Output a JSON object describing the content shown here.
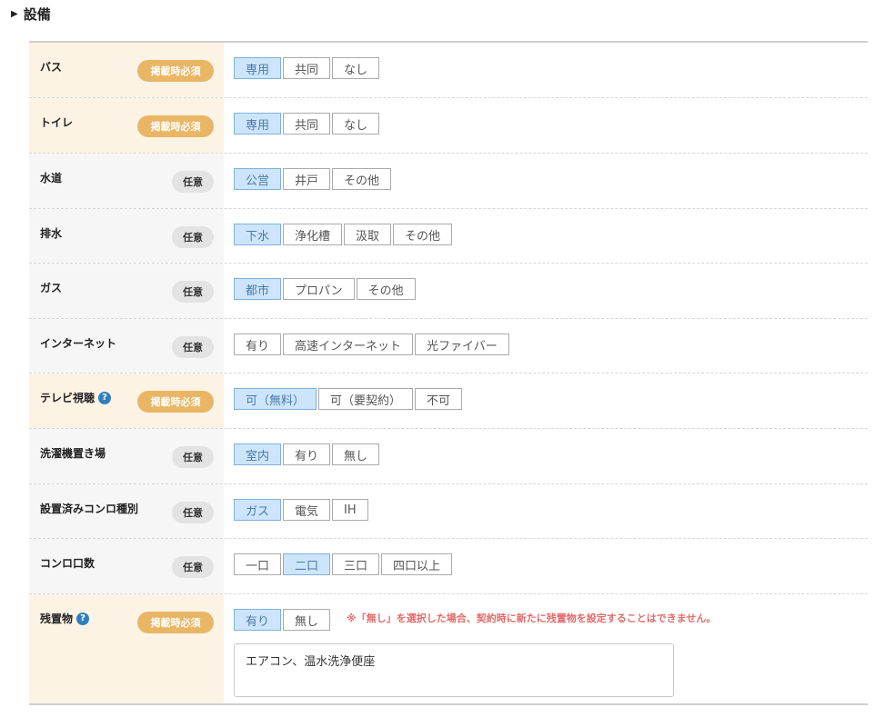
{
  "section": {
    "icon": "triangle-right-icon",
    "title": "設備"
  },
  "rows": [
    {
      "label": "バス",
      "help": false,
      "badge": "掲載時必須",
      "badge_type": "required",
      "options": [
        {
          "label": "専用",
          "selected": true
        },
        {
          "label": "共同",
          "selected": false
        },
        {
          "label": "なし",
          "selected": false
        }
      ]
    },
    {
      "label": "トイレ",
      "help": false,
      "badge": "掲載時必須",
      "badge_type": "required",
      "options": [
        {
          "label": "専用",
          "selected": true
        },
        {
          "label": "共同",
          "selected": false
        },
        {
          "label": "なし",
          "selected": false
        }
      ]
    },
    {
      "label": "水道",
      "help": false,
      "badge": "任意",
      "badge_type": "optional",
      "options": [
        {
          "label": "公営",
          "selected": true
        },
        {
          "label": "井戸",
          "selected": false
        },
        {
          "label": "その他",
          "selected": false
        }
      ]
    },
    {
      "label": "排水",
      "help": false,
      "badge": "任意",
      "badge_type": "optional",
      "options": [
        {
          "label": "下水",
          "selected": true
        },
        {
          "label": "浄化槽",
          "selected": false
        },
        {
          "label": "汲取",
          "selected": false
        },
        {
          "label": "その他",
          "selected": false
        }
      ]
    },
    {
      "label": "ガス",
      "help": false,
      "badge": "任意",
      "badge_type": "optional",
      "options": [
        {
          "label": "都市",
          "selected": true
        },
        {
          "label": "プロパン",
          "selected": false
        },
        {
          "label": "その他",
          "selected": false
        }
      ]
    },
    {
      "label": "インターネット",
      "help": false,
      "badge": "任意",
      "badge_type": "optional",
      "options": [
        {
          "label": "有り",
          "selected": false
        },
        {
          "label": "高速インターネット",
          "selected": false
        },
        {
          "label": "光ファイバー",
          "selected": false
        }
      ]
    },
    {
      "label": "テレビ視聴",
      "help": true,
      "help_icon": "?",
      "badge": "掲載時必須",
      "badge_type": "required",
      "options": [
        {
          "label": "可（無料）",
          "selected": true
        },
        {
          "label": "可（要契約）",
          "selected": false
        },
        {
          "label": "不可",
          "selected": false
        }
      ]
    },
    {
      "label": "洗濯機置き場",
      "help": false,
      "badge": "任意",
      "badge_type": "optional",
      "options": [
        {
          "label": "室内",
          "selected": true
        },
        {
          "label": "有り",
          "selected": false
        },
        {
          "label": "無し",
          "selected": false
        }
      ]
    },
    {
      "label": "設置済みコンロ種別",
      "help": false,
      "badge": "任意",
      "badge_type": "optional",
      "options": [
        {
          "label": "ガス",
          "selected": true
        },
        {
          "label": "電気",
          "selected": false
        },
        {
          "label": "IH",
          "selected": false
        }
      ]
    },
    {
      "label": "コンロ口数",
      "help": false,
      "badge": "任意",
      "badge_type": "optional",
      "options": [
        {
          "label": "一口",
          "selected": false
        },
        {
          "label": "二口",
          "selected": true
        },
        {
          "label": "三口",
          "selected": false
        },
        {
          "label": "四口以上",
          "selected": false
        }
      ]
    },
    {
      "label": "残置物",
      "help": true,
      "help_icon": "?",
      "badge": "掲載時必須",
      "badge_type": "required",
      "options": [
        {
          "label": "有り",
          "selected": true
        },
        {
          "label": "無し",
          "selected": false
        }
      ],
      "note": "※「無し」を選択した場合、契約時に新たに残置物を設定することはできません。",
      "textarea_value": "エアコン、温水洗浄便座"
    }
  ],
  "colors": {
    "required_badge": "#e9b666",
    "optional_badge": "#e3e3e3",
    "selected_option": "#cde5fb",
    "required_label_bg": "#fdf3e4",
    "note_text": "#e26b6b",
    "help_icon": "#2f7fbf"
  }
}
